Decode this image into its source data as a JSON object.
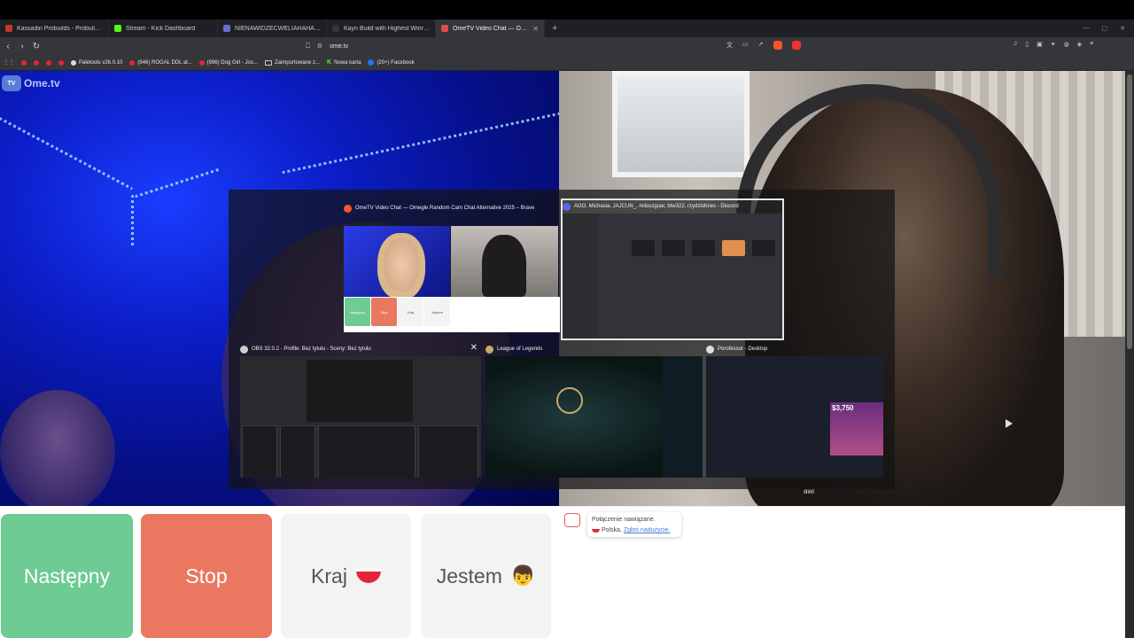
{
  "browser": {
    "tabs": [
      {
        "label": "Kassadin Probuilds - Probuild.gg",
        "color": "#c0392b",
        "active": false
      },
      {
        "label": "Stream - Kick Dashboard",
        "color": "#53fc18",
        "active": false
      },
      {
        "label": "NIENAWIDZECWELIAHAHAH - Staty",
        "color": "#6b6bd6",
        "active": false
      },
      {
        "label": "Kayn Build with Highest Winrate - Lo",
        "color": "#333333",
        "active": false
      },
      {
        "label": "OmeTV Video Chat — Omeg",
        "color": "#e04a4a",
        "active": true
      }
    ],
    "new_tab": "+",
    "url": "ome.tv",
    "bookmarks": [
      {
        "label": "Paletools v26.0.10",
        "kind": "dot"
      },
      {
        "label": "(946) ROGAL DDL al...",
        "kind": "dot"
      },
      {
        "label": "(996) Dog Girl - Jos...",
        "kind": "dot"
      },
      {
        "label": "Zaimportowane z...",
        "kind": "folder"
      },
      {
        "label": "Nowa karta",
        "kind": "kick"
      },
      {
        "label": "(20+) Facebook",
        "kind": "fb"
      }
    ]
  },
  "ome": {
    "logo": "Ome.tv",
    "logo_badge": "TV",
    "buttons": {
      "next": "Następny",
      "stop": "Stop",
      "country": "Kraj",
      "gender": "Jestem"
    },
    "chat": {
      "connected": "Połączenie nawiązane.",
      "country": "Polska.",
      "report": "Zgłoś nadużycie."
    },
    "watermark": "awi"
  },
  "switcher": {
    "windows": [
      {
        "title": "OmeTV Video Chat — Omegle Random Cam Chat Alternative 2025 – Brave",
        "icon_color": "#fb542b"
      },
      {
        "title": "AGO, Michasia, JAJCUN_, miloszguar, btw322, rzydzlohnes - Discord",
        "icon_color": "#5865f2"
      },
      {
        "title": "OBS 32.0.2 - Profile: Bez tytułu - Sceny: Bez tytułu",
        "icon_color": "#cccccc"
      },
      {
        "title": "League of Legends",
        "icon_color": "#c8aa6e"
      },
      {
        "title": "Porofessor - Desktop",
        "icon_color": "#dddddd"
      }
    ],
    "mini_buttons": [
      "Następny",
      "Stop",
      "Kraj",
      "Jestem"
    ],
    "poro_price": "$3,750"
  }
}
